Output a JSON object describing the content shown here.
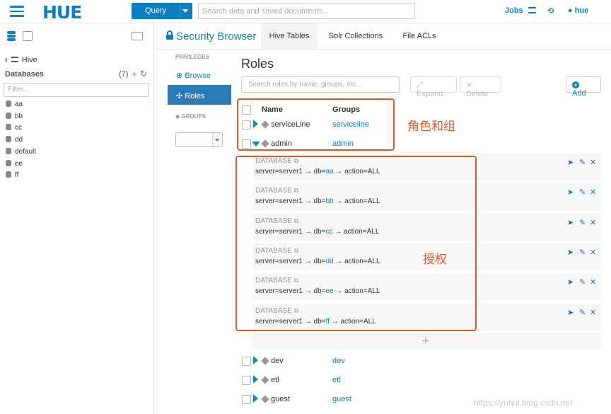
{
  "header": {
    "logo": "HUE",
    "query_label": "Query",
    "search_placeholder": "Search data and saved documents...",
    "jobs_label": "Jobs",
    "user_label": "hue"
  },
  "left": {
    "back_label": "Hive",
    "databases_label": "Databases",
    "db_count": "(7)",
    "filter_placeholder": "Filter...",
    "databases": [
      "aa",
      "bb",
      "cc",
      "dd",
      "default",
      "ee",
      "ff"
    ]
  },
  "app": {
    "title": "Security Browser",
    "tabs": [
      "Hive Tables",
      "Solr Collections",
      "File ACLs"
    ]
  },
  "sidenav": {
    "privileges_label": "PRIVILEGES",
    "browse_label": "Browse",
    "roles_label": "Roles",
    "groups_label": "GROUPS"
  },
  "roles": {
    "title": "Roles",
    "search_placeholder": "Search roles by name, groups, etc...",
    "expand_label": "Expand",
    "delete_label": "Delete",
    "add_label": "Add",
    "col_name": "Name",
    "col_groups": "Groups",
    "top_rows": [
      {
        "name": "serviceLine",
        "group": "serviceline"
      },
      {
        "name": "admin",
        "group": "admin"
      }
    ],
    "privileges": [
      {
        "type": "DATABASE",
        "prefix": "server=server1 → db=",
        "db": "aa",
        "suffix": " → action=ALL"
      },
      {
        "type": "DATABASE",
        "prefix": "server=server1 → db=",
        "db": "bb",
        "suffix": " → action=ALL"
      },
      {
        "type": "DATABASE",
        "prefix": "server=server1 → db=",
        "db": "cc",
        "suffix": " → action=ALL"
      },
      {
        "type": "DATABASE",
        "prefix": "server=server1 → db=",
        "db": "dd",
        "suffix": " → action=ALL"
      },
      {
        "type": "DATABASE",
        "prefix": "server=server1 → db=",
        "db": "ee",
        "suffix": " → action=ALL"
      },
      {
        "type": "DATABASE",
        "prefix": "server=server1 → db=",
        "db": "ff",
        "suffix": " → action=ALL"
      }
    ],
    "bottom_rows": [
      {
        "name": "dev",
        "group": "dev"
      },
      {
        "name": "etl",
        "group": "etl"
      },
      {
        "name": "guest",
        "group": "guest"
      }
    ]
  },
  "annotations": {
    "roles_groups": "角色和组",
    "authorization": "授权"
  },
  "watermark": "https://yuhui.blog.csdn.net"
}
